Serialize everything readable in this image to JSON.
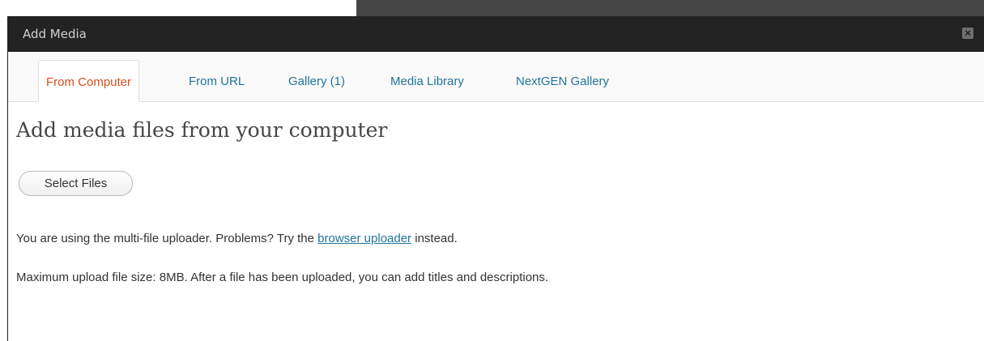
{
  "dialog": {
    "title": "Add Media",
    "close_label": "×"
  },
  "tabs": [
    {
      "label": "From Computer",
      "active": true
    },
    {
      "label": "From URL",
      "active": false
    },
    {
      "label": "Gallery (1)",
      "active": false
    },
    {
      "label": "Media Library",
      "active": false
    },
    {
      "label": "NextGEN Gallery",
      "active": false
    }
  ],
  "content": {
    "heading": "Add media files from your computer",
    "select_files_label": "Select Files",
    "uploader_notice": {
      "before": "You are using the multi-file uploader. Problems? Try the ",
      "link": "browser uploader",
      "after": " instead."
    },
    "max_size_notice": "Maximum upload file size: 8MB. After a file has been uploaded, you can add titles and descriptions."
  },
  "colors": {
    "titlebar": "#222222",
    "tab_link": "#21759b",
    "tab_active": "#d54e21",
    "heading": "#464646"
  }
}
